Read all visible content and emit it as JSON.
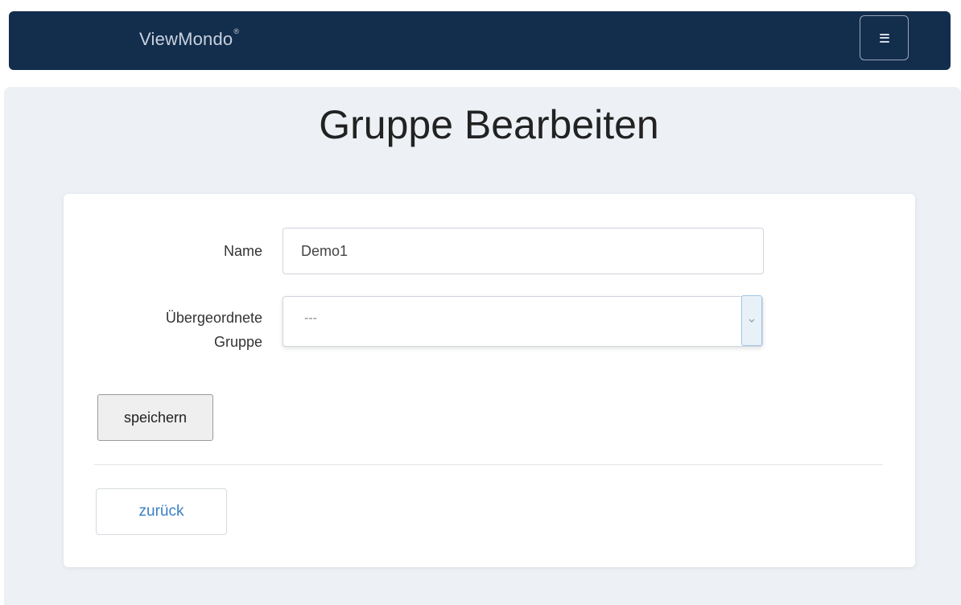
{
  "navbar": {
    "brand": "ViewMondo",
    "brand_mark": "®",
    "menu_icon": "hamburger-icon"
  },
  "page": {
    "title": "Gruppe Bearbeiten"
  },
  "form": {
    "name_label": "Name",
    "name_value": "Demo1",
    "parent_label_line1": "Übergeordnete",
    "parent_label_line2": "Gruppe",
    "parent_selected": "---",
    "save_label": "speichern",
    "back_label": "zurück"
  },
  "colors": {
    "navbar_bg": "#132d4d",
    "content_bg": "#edf1f5",
    "link": "#3a7fc4"
  }
}
